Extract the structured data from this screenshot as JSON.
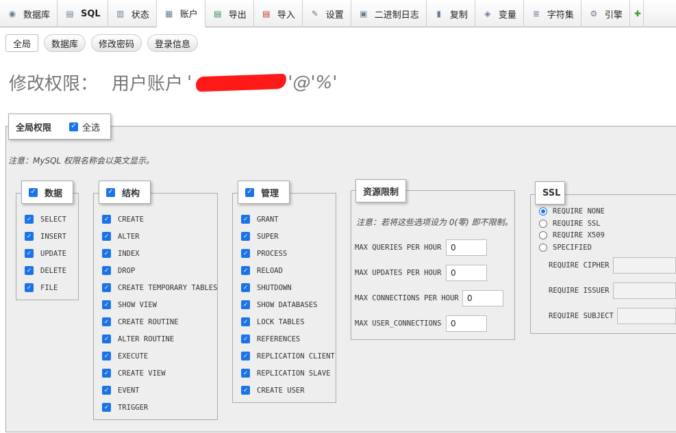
{
  "tabs": [
    {
      "label": "数据库",
      "icon": "database-icon",
      "glyph": "◉"
    },
    {
      "label": "SQL",
      "icon": "sql-icon",
      "glyph": "▤"
    },
    {
      "label": "状态",
      "icon": "status-chart-icon",
      "glyph": "▥"
    },
    {
      "label": "账户",
      "icon": "accounts-icon",
      "glyph": "▦"
    },
    {
      "label": "导出",
      "icon": "export-icon",
      "glyph": "▤"
    },
    {
      "label": "导入",
      "icon": "import-icon",
      "glyph": "▤"
    },
    {
      "label": "设置",
      "icon": "wrench-icon",
      "glyph": "✎"
    },
    {
      "label": "二进制日志",
      "icon": "binlog-icon",
      "glyph": "▣"
    },
    {
      "label": "复制",
      "icon": "replication-icon",
      "glyph": "▮"
    },
    {
      "label": "变量",
      "icon": "variables-icon",
      "glyph": "◈"
    },
    {
      "label": "字符集",
      "icon": "charset-icon",
      "glyph": "≣"
    },
    {
      "label": "引擎",
      "icon": "engine-icon",
      "glyph": "⚙"
    }
  ],
  "plugin_icon": "plugin-icon",
  "subnav": [
    "全局",
    "数据库",
    "修改密码",
    "登录信息"
  ],
  "heading": {
    "title": "修改权限：",
    "account_label": "用户账户",
    "name_prefix": "'",
    "host": "'@'%'"
  },
  "global": {
    "legend": "全局权限",
    "select_all": "全选"
  },
  "note": "注意：MySQL 权限名称会以英文显示。",
  "groups": {
    "data": {
      "label": "数据",
      "items": [
        "SELECT",
        "INSERT",
        "UPDATE",
        "DELETE",
        "FILE"
      ]
    },
    "structure": {
      "label": "结构",
      "items": [
        "CREATE",
        "ALTER",
        "INDEX",
        "DROP",
        "CREATE TEMPORARY TABLES",
        "SHOW VIEW",
        "CREATE ROUTINE",
        "ALTER ROUTINE",
        "EXECUTE",
        "CREATE VIEW",
        "EVENT",
        "TRIGGER"
      ]
    },
    "admin": {
      "label": "管理",
      "items": [
        "GRANT",
        "SUPER",
        "PROCESS",
        "RELOAD",
        "SHUTDOWN",
        "SHOW DATABASES",
        "LOCK TABLES",
        "REFERENCES",
        "REPLICATION CLIENT",
        "REPLICATION SLAVE",
        "CREATE USER"
      ]
    }
  },
  "resources": {
    "label": "资源限制",
    "note": "注意：若将这些选项设为 0(零) 即不限制。",
    "fields": [
      {
        "label": "MAX QUERIES PER HOUR",
        "value": "0"
      },
      {
        "label": "MAX UPDATES PER HOUR",
        "value": "0"
      },
      {
        "label": "MAX CONNECTIONS PER HOUR",
        "value": "0"
      },
      {
        "label": "MAX USER_CONNECTIONS",
        "value": "0"
      }
    ]
  },
  "ssl": {
    "label": "SSL",
    "options": [
      "REQUIRE NONE",
      "REQUIRE SSL",
      "REQUIRE X509",
      "SPECIFIED"
    ],
    "selected": "REQUIRE NONE",
    "fields": [
      "REQUIRE CIPHER",
      "REQUIRE ISSUER",
      "REQUIRE SUBJECT"
    ]
  },
  "colors": {
    "checkbox": "#1a73e8",
    "redaction": "#ff1a1a"
  }
}
